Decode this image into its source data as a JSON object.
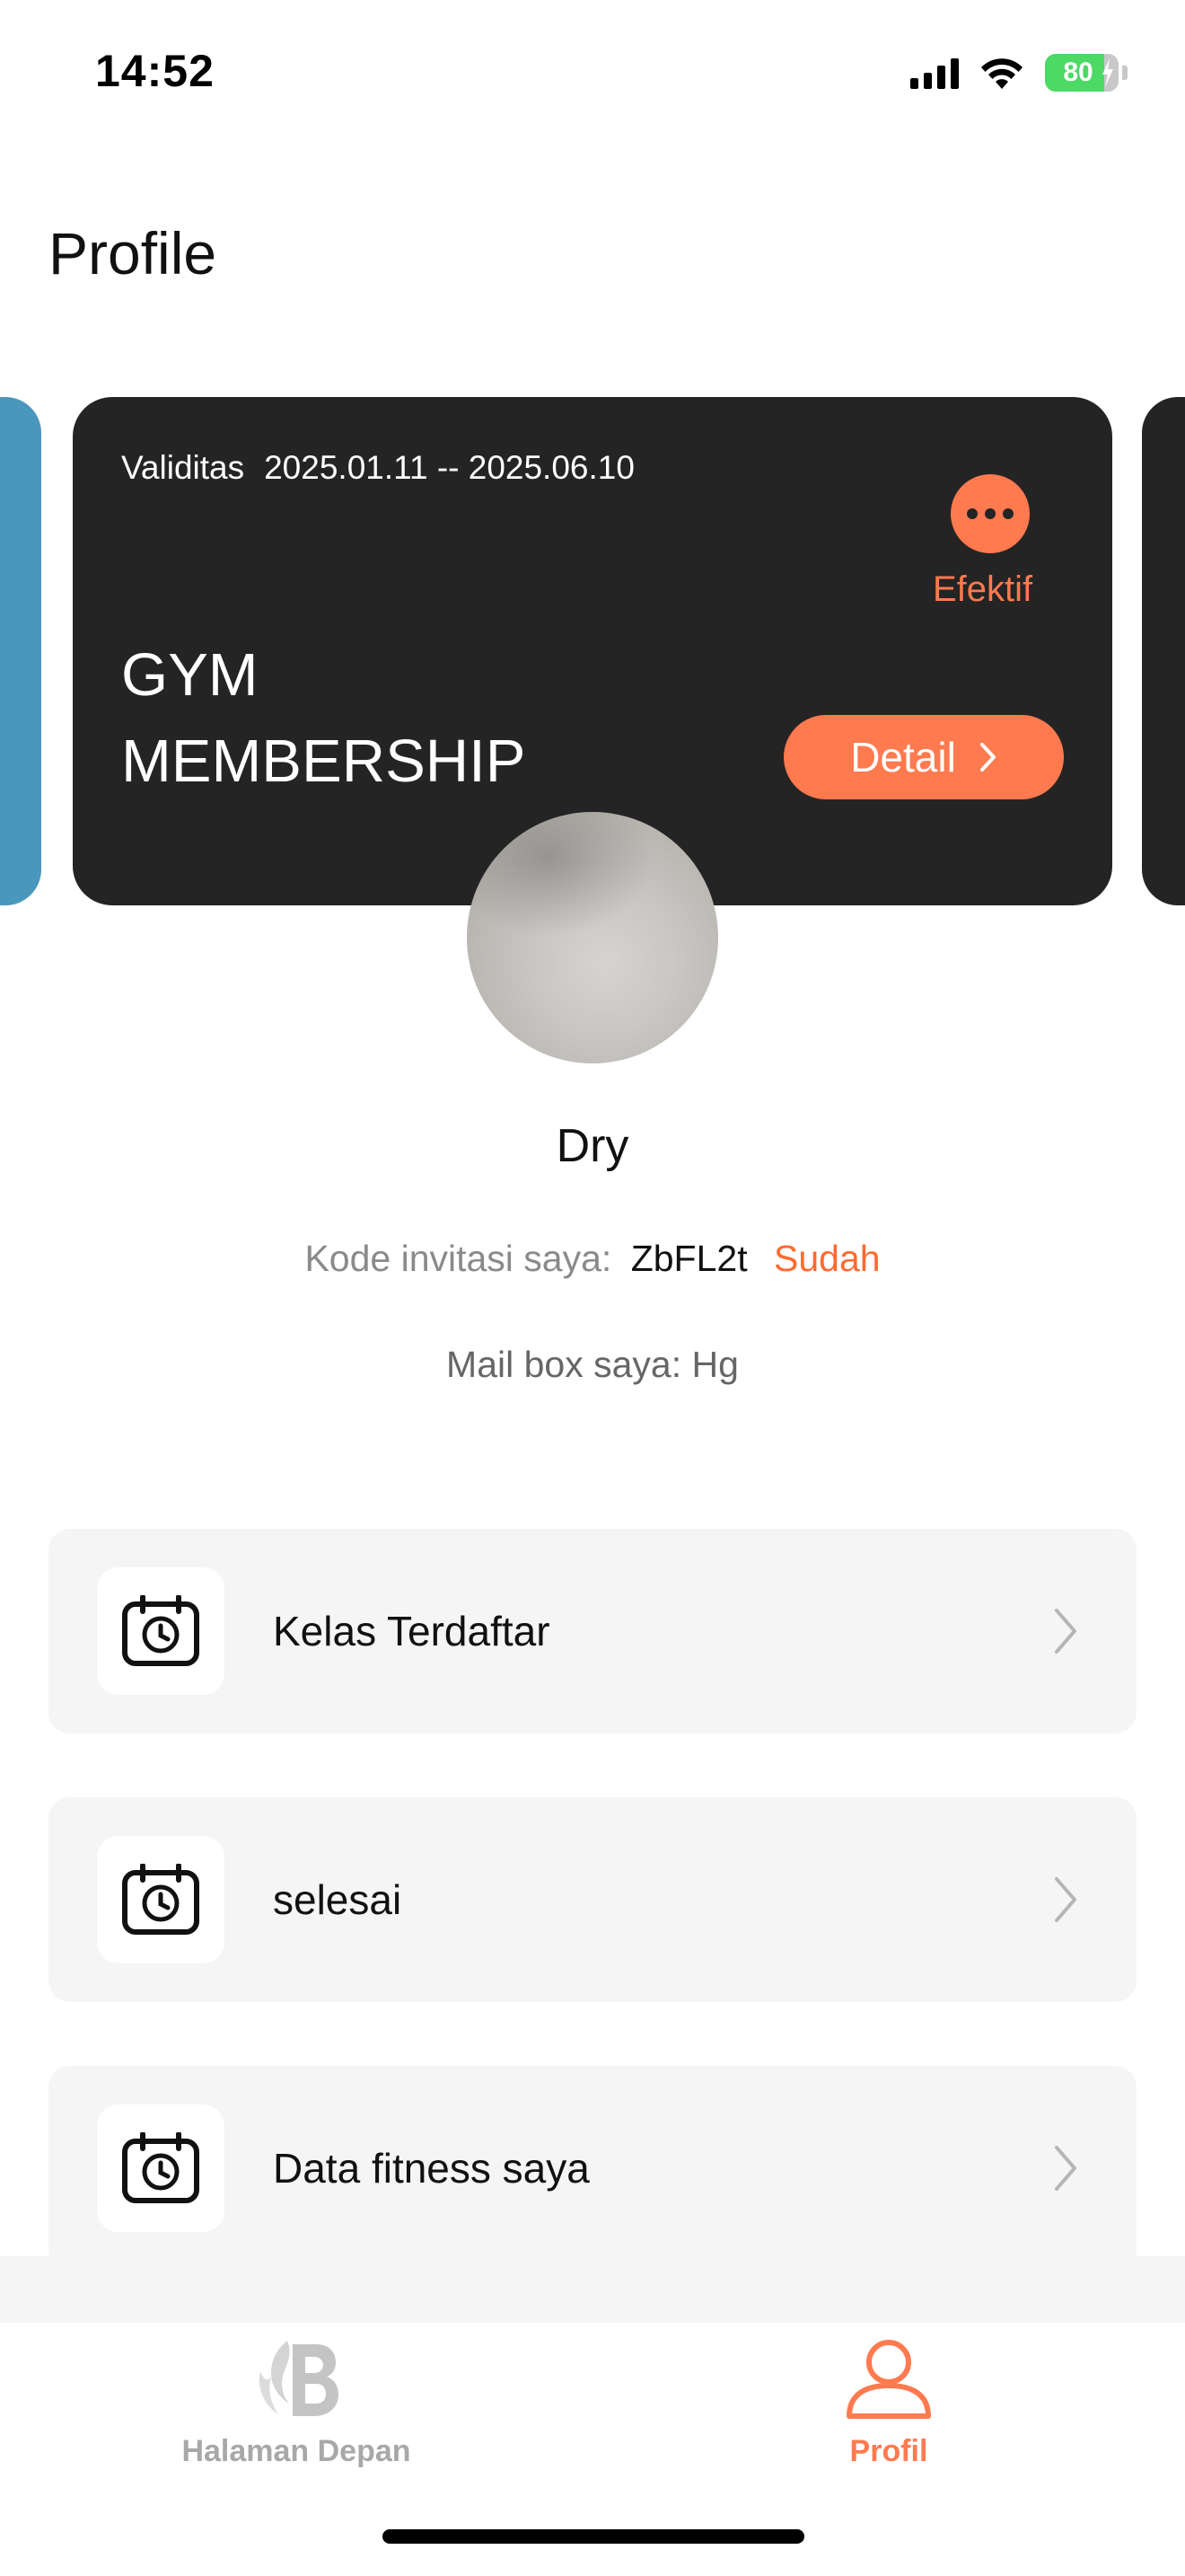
{
  "status_bar": {
    "time": "14:52",
    "battery_percent": "80"
  },
  "page": {
    "title": "Profile"
  },
  "membership_card": {
    "validity_label": "Validitas",
    "validity_range": "2025.01.11 -- 2025.06.10",
    "status": "Efektif",
    "title": "GYM MEMBERSHIP",
    "detail_label": "Detail",
    "accent_color": "#ff7a4f",
    "card_color": "#242424",
    "peek_left_color": "#4a97bd"
  },
  "profile": {
    "name": "Dry",
    "invite_label": "Kode invitasi saya:",
    "invite_code": "ZbFL2t",
    "invite_status": "Sudah",
    "mailbox_label": "Mail box saya:",
    "mailbox_value": "Hg"
  },
  "menu": {
    "items": [
      {
        "label": "Kelas Terdaftar",
        "icon": "calendar-clock-icon"
      },
      {
        "label": "selesai",
        "icon": "calendar-clock-icon"
      },
      {
        "label": "Data fitness saya",
        "icon": "calendar-clock-icon"
      }
    ]
  },
  "tabbar": {
    "home_label": "Halaman Depan",
    "profile_label": "Profil",
    "active_tab": "Profil",
    "active_color": "#ff7a4f",
    "inactive_color": "#a8a8a8"
  }
}
